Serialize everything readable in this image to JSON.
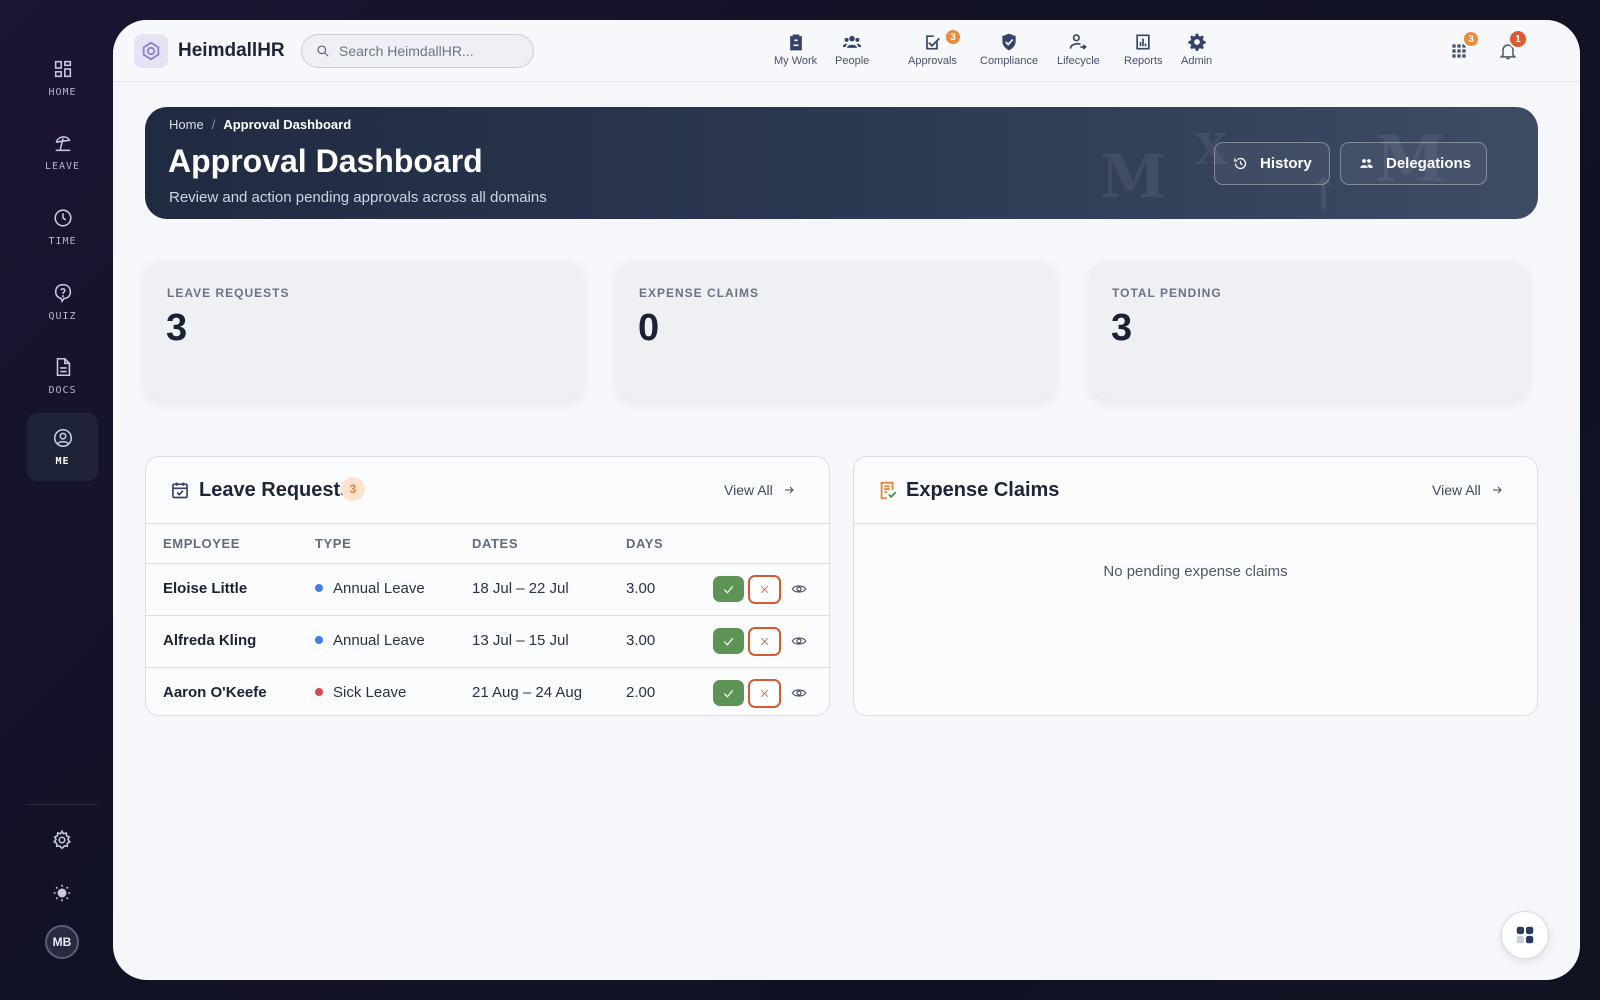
{
  "rail": {
    "items": [
      {
        "label": "HOME",
        "icon": "dashboard-icon"
      },
      {
        "label": "LEAVE",
        "icon": "beach-umbrella-icon"
      },
      {
        "label": "TIME",
        "icon": "clock-icon"
      },
      {
        "label": "QUIZ",
        "icon": "question-icon"
      },
      {
        "label": "DOCS",
        "icon": "document-icon"
      },
      {
        "label": "ME",
        "icon": "account-circle-icon",
        "active": true
      }
    ],
    "avatar_initials": "MB"
  },
  "topbar": {
    "brand": "HeimdallHR",
    "search_placeholder": "Search HeimdallHR...",
    "nav": [
      {
        "label": "My Work",
        "icon": "clipboard-icon"
      },
      {
        "label": "People",
        "icon": "people-icon"
      },
      {
        "label": "Approvals",
        "icon": "approvals-icon",
        "badge": "3"
      },
      {
        "label": "Compliance",
        "icon": "shield-check-icon"
      },
      {
        "label": "Lifecycle",
        "icon": "person-arrow-icon"
      },
      {
        "label": "Reports",
        "icon": "bar-chart-icon"
      },
      {
        "label": "Admin",
        "icon": "gear-icon"
      }
    ],
    "apps_badge": "3",
    "notifications_badge": "1"
  },
  "hero": {
    "breadcrumb_home": "Home",
    "breadcrumb_sep": "/",
    "breadcrumb_current": "Approval Dashboard",
    "title": "Approval Dashboard",
    "subtitle": "Review and action pending approvals across all domains",
    "history_label": "History",
    "delegations_label": "Delegations"
  },
  "stats": [
    {
      "label": "LEAVE REQUESTS",
      "value": "3"
    },
    {
      "label": "EXPENSE CLAIMS",
      "value": "0"
    },
    {
      "label": "TOTAL PENDING",
      "value": "3"
    }
  ],
  "leave_card": {
    "title": "Leave Requests",
    "count": "3",
    "view_all": "View All",
    "columns": [
      "EMPLOYEE",
      "TYPE",
      "DATES",
      "DAYS"
    ],
    "rows": [
      {
        "employee": "Eloise Little",
        "type": "Annual Leave",
        "type_color": "#3f7ee8",
        "dates": "18 Jul – 22 Jul",
        "days": "3.00"
      },
      {
        "employee": "Alfreda Kling",
        "type": "Annual Leave",
        "type_color": "#3f7ee8",
        "dates": "13 Jul – 15 Jul",
        "days": "3.00"
      },
      {
        "employee": "Aaron O'Keefe",
        "type": "Sick Leave",
        "type_color": "#e04848",
        "dates": "21 Aug – 24 Aug",
        "days": "2.00"
      }
    ]
  },
  "expense_card": {
    "title": "Expense Claims",
    "view_all": "View All",
    "empty_text": "No pending expense claims"
  },
  "colors": {
    "accent": "#354269",
    "approve": "#5d9455",
    "reject": "#d8582f",
    "badge": "#ec8a3c"
  }
}
